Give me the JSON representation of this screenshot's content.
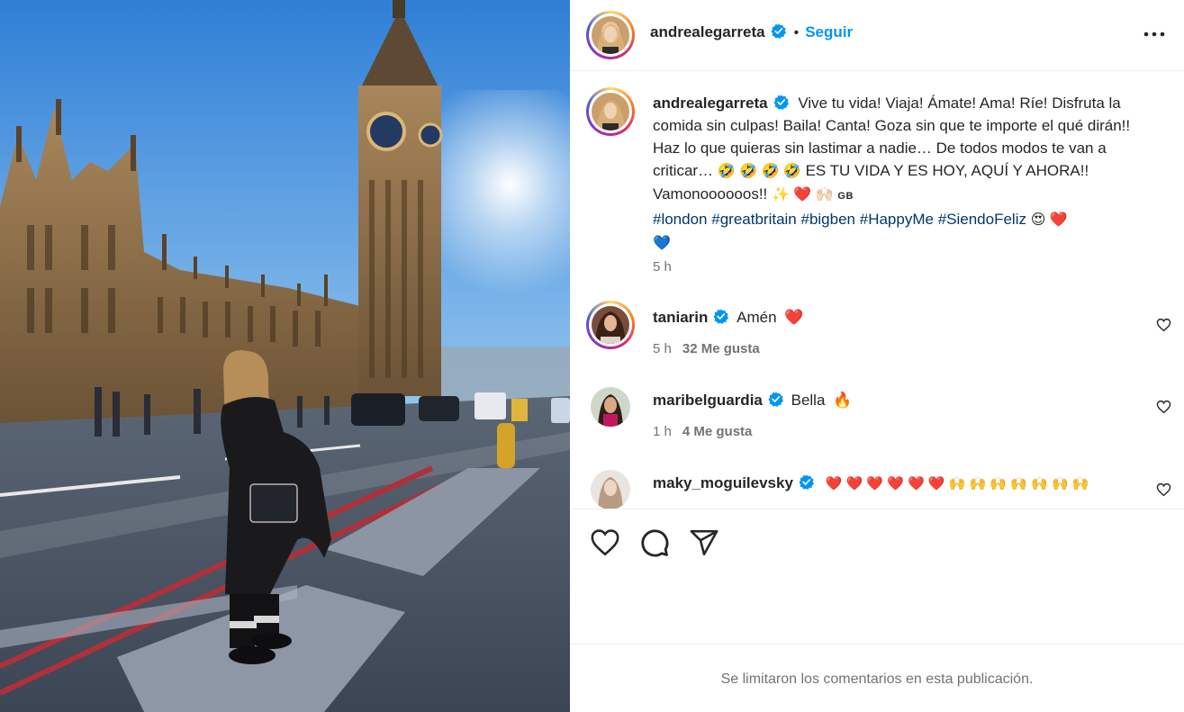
{
  "post": {
    "author": "andrealegarreta",
    "separator": "•",
    "follow_label": "Seguir",
    "caption_text": "Vive tu vida! Viaja! Ámate! Ama! Ríe! Disfruta la comida sin culpas! Baila! Canta! Goza sin que te importe el qué dirán!! Haz lo que quieras sin lastimar a nadie… De todos modos te van a criticar…",
    "caption_emojis_1": "🤣 🤣 🤣 🤣",
    "caption_text_2": "ES TU VIDA Y ES HOY, AQUÍ Y AHORA!! Vamonoooooos!!",
    "caption_emojis_2": "✨ ❤️ 🙌🏻",
    "caption_flag": "GB",
    "hashtags": [
      "#london",
      "#greatbritain",
      "#bigben",
      "#HappyMe",
      "#SiendoFeliz"
    ],
    "caption_emojis_3": "😍 ❤️",
    "caption_emojis_4": "💙",
    "time": "5 h"
  },
  "comments": [
    {
      "user": "taniarin",
      "text": "Amén",
      "emoji": "❤️",
      "time": "5 h",
      "likes": "32 Me gusta"
    },
    {
      "user": "maribelguardia",
      "text": "Bella",
      "emoji": "🔥",
      "time": "1 h",
      "likes": "4 Me gusta"
    },
    {
      "user": "maky_moguilevsky",
      "text": "",
      "emoji": "❤️ ❤️ ❤️ ❤️ ❤️ ❤️ 🙌 🙌 🙌 🙌 🙌 🙌 🙌"
    }
  ],
  "footer": {
    "limited_comments": "Se limitaron los comentarios en esta publicación."
  },
  "icons": {
    "more": "more-options-icon",
    "like": "heart-icon",
    "comment": "comment-icon",
    "share": "share-icon",
    "verified": "verified-badge-icon"
  },
  "colors": {
    "link_blue": "#0095f6",
    "hashtag_blue": "#00376b",
    "muted": "#737373",
    "verified": "#0095f6"
  }
}
